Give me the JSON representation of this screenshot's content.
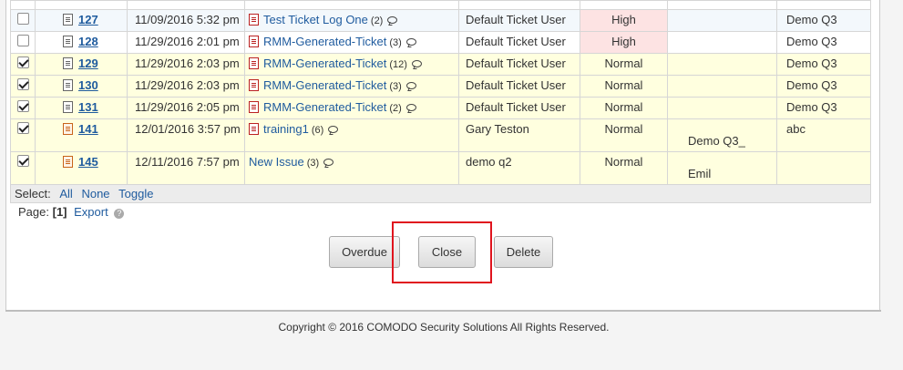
{
  "tickets": [
    {
      "checked": false,
      "id": "127",
      "date": "11/09/2016 5:32 pm",
      "subject": "Test Ticket Log One",
      "count": "(2)",
      "user": "Default Ticket User",
      "priority": "High",
      "assignee": "",
      "group": "Demo Q3",
      "icon": "doc",
      "row_style": "row-blueish"
    },
    {
      "checked": false,
      "id": "128",
      "date": "11/29/2016 2:01 pm",
      "subject": "RMM-Generated-Ticket",
      "count": "(3)",
      "user": "Default Ticket User",
      "priority": "High",
      "assignee": "",
      "group": "Demo Q3",
      "icon": "doc",
      "row_style": "row-white"
    },
    {
      "checked": true,
      "id": "129",
      "date": "11/29/2016 2:03 pm",
      "subject": "RMM-Generated-Ticket",
      "count": "(12)",
      "user": "Default Ticket User",
      "priority": "Normal",
      "assignee": "",
      "group": "Demo Q3",
      "icon": "doc",
      "row_style": "row-yellow"
    },
    {
      "checked": true,
      "id": "130",
      "date": "11/29/2016 2:03 pm",
      "subject": "RMM-Generated-Ticket",
      "count": "(3)",
      "user": "Default Ticket User",
      "priority": "Normal",
      "assignee": "",
      "group": "Demo Q3",
      "icon": "doc",
      "row_style": "row-yellow"
    },
    {
      "checked": true,
      "id": "131",
      "date": "11/29/2016 2:05 pm",
      "subject": "RMM-Generated-Ticket",
      "count": "(2)",
      "user": "Default Ticket User",
      "priority": "Normal",
      "assignee": "",
      "group": "Demo Q3",
      "icon": "doc",
      "row_style": "row-yellow"
    },
    {
      "checked": true,
      "id": "141",
      "date": "12/01/2016 3:57 pm",
      "subject": "training1",
      "count": "(6)",
      "user": "Gary Teston",
      "priority": "Normal",
      "assignee": "Demo Q3_",
      "group": "abc",
      "icon": "doc-orange",
      "row_style": "row-yellow"
    },
    {
      "checked": true,
      "id": "145",
      "date": "12/11/2016 7:57 pm",
      "subject": "New Issue",
      "count": "(3)",
      "user": "demo q2",
      "priority": "Normal",
      "assignee": "Emil",
      "group": "",
      "icon": "doc-orange",
      "row_style": "row-yellow"
    }
  ],
  "select": {
    "label": "Select:",
    "all": "All",
    "none": "None",
    "toggle": "Toggle"
  },
  "pager": {
    "label": "Page:",
    "current": "[1]",
    "export": "Export",
    "help": "?"
  },
  "buttons": {
    "overdue": "Overdue",
    "close": "Close",
    "delete": "Delete"
  },
  "footer": {
    "copyright": "Copyright © 2016 COMODO Security Solutions All Rights Reserved."
  }
}
